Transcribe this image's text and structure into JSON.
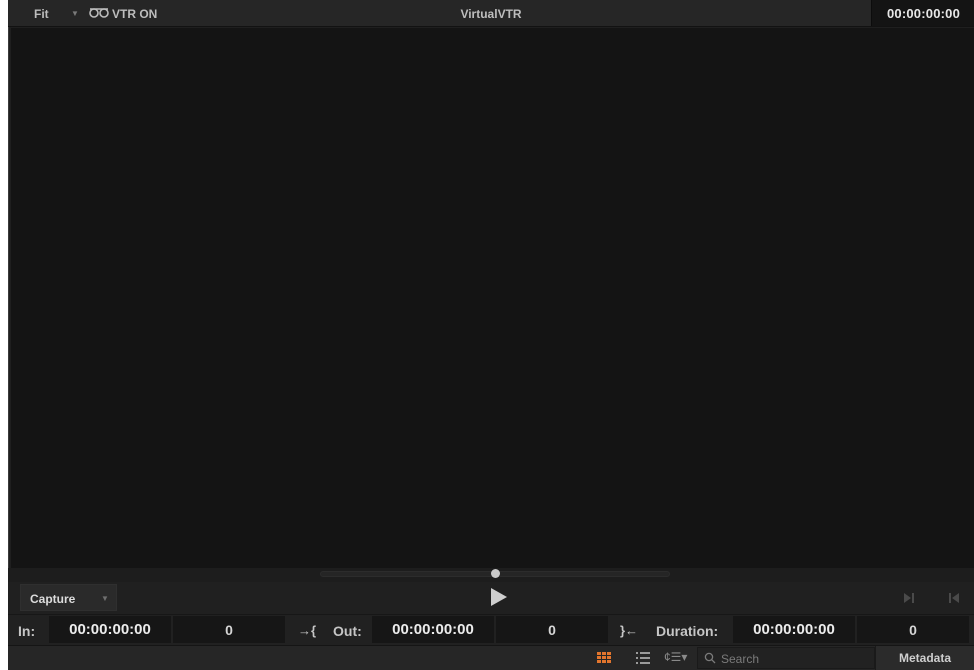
{
  "header": {
    "zoom_label": "Fit",
    "vtr_label": "VTR ON",
    "title": "VirtualVTR",
    "timecode": "00:00:00:00"
  },
  "transport": {
    "capture_label": "Capture"
  },
  "timecodes": {
    "in_label": "In:",
    "in_value": "00:00:00:00",
    "in_frames": "0",
    "out_label": "Out:",
    "out_value": "00:00:00:00",
    "out_frames": "0",
    "duration_label": "Duration:",
    "duration_value": "00:00:00:00",
    "duration_frames": "0",
    "mark_in_glyph": "→{",
    "mark_out_glyph": "}←"
  },
  "bottom": {
    "search_placeholder": "Search",
    "metadata_label": "Metadata"
  },
  "colors": {
    "accent_orange": "#e2752d",
    "panel_bg": "#1f1f1f",
    "viewer_bg": "#141414"
  },
  "icons": [
    "chevron-down-icon",
    "vtr-link-icon",
    "play-icon",
    "next-frame-icon",
    "prev-frame-icon",
    "grid-view-icon",
    "list-view-icon",
    "sort-icon",
    "search-icon"
  ]
}
